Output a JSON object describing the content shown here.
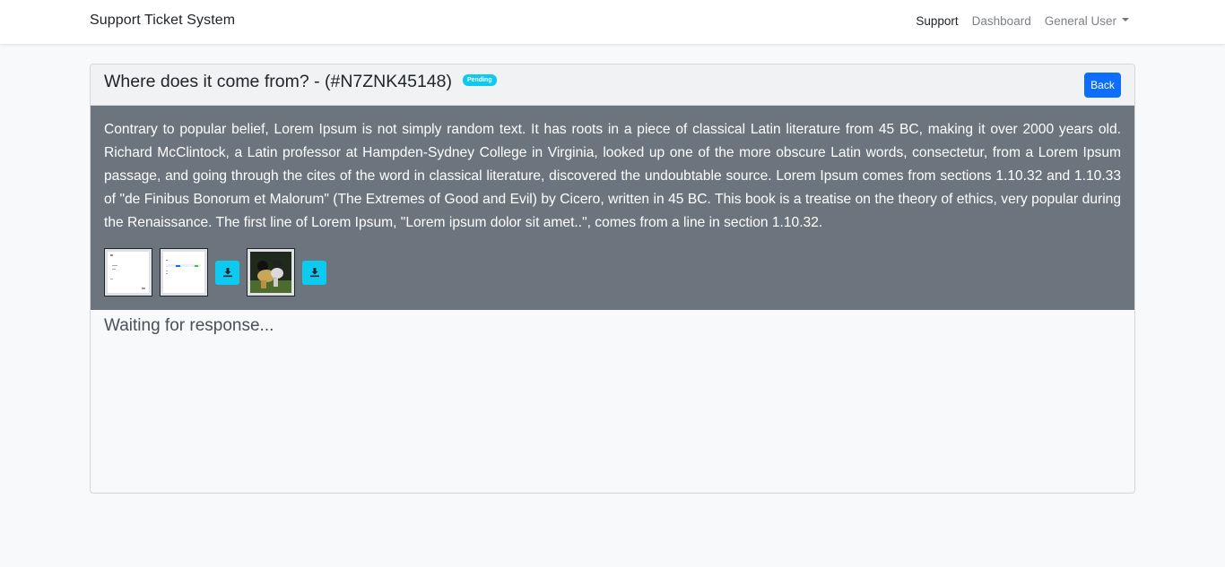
{
  "navbar": {
    "brand": "Support Ticket System",
    "links": [
      "Support",
      "Dashboard",
      "General User"
    ]
  },
  "ticket": {
    "title": "Where does it come from? - (#N7ZNK45148)",
    "status": "Pending",
    "back_label": "Back",
    "description": "Contrary to popular belief, Lorem Ipsum is not simply random text. It has roots in a piece of classical Latin literature from 45 BC, making it over 2000 years old. Richard McClintock, a Latin professor at Hampden-Sydney College in Virginia, looked up one of the more obscure Latin words, consectetur, from a Lorem Ipsum passage, and going through the cites of the word in classical literature, discovered the undoubtable source. Lorem Ipsum comes from sections 1.10.32 and 1.10.33 of \"de Finibus Bonorum et Malorum\" (The Extremes of Good and Evil) by Cicero, written in 45 BC. This book is a treatise on the theory of ethics, very popular during the Renaissance. The first line of Lorem Ipsum, \"Lorem ipsum dolor sit amet..\", comes from a line in section 1.10.32.",
    "attachments": [
      "document-thumbnail",
      "document-thumbnail",
      "download-icon",
      "photo-thumbnail",
      "download-icon"
    ],
    "response_text": "Waiting for response..."
  },
  "colors": {
    "primary": "#0d6efd",
    "info": "#0dcaf0",
    "body_bg": "#6c757d"
  }
}
